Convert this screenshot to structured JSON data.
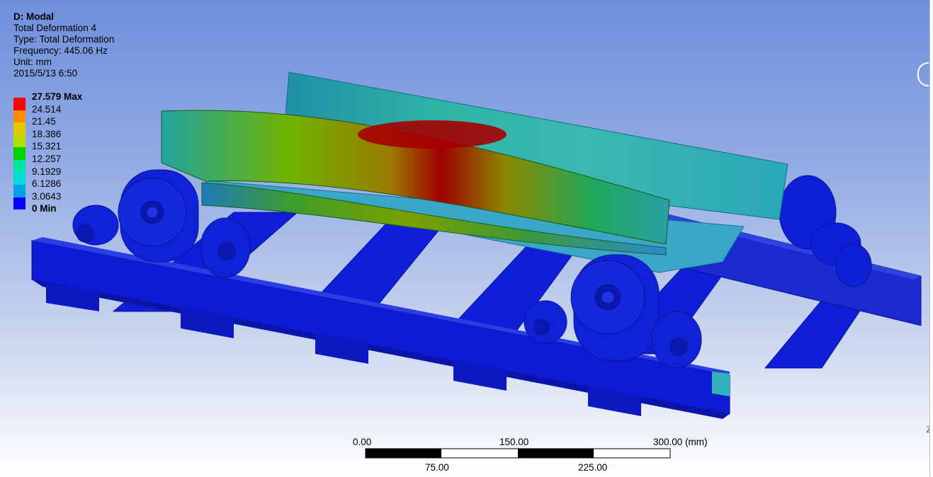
{
  "info": {
    "title": "D: Modal",
    "result": "Total Deformation 4",
    "type": "Type: Total Deformation",
    "frequency": "Frequency: 445.06 Hz",
    "unit": "Unit: mm",
    "timestamp": "2015/5/13 6:50"
  },
  "legend": [
    {
      "label": "27.579 Max",
      "color": "#ff0000",
      "bold": true
    },
    {
      "label": "24.514",
      "color": "#ff8c00",
      "bold": false
    },
    {
      "label": "21.45",
      "color": "#e6c800",
      "bold": false
    },
    {
      "label": "18.386",
      "color": "#b4dc00",
      "bold": false
    },
    {
      "label": "15.321",
      "color": "#00d200",
      "bold": false
    },
    {
      "label": "12.257",
      "color": "#00e6a0",
      "bold": false
    },
    {
      "label": "9.1929",
      "color": "#00dcdc",
      "bold": false
    },
    {
      "label": "6.1286",
      "color": "#00a0e6",
      "bold": false
    },
    {
      "label": "3.0643",
      "color": "#0000ff",
      "bold": false
    },
    {
      "label": "0 Min",
      "color": "#0000ff",
      "bold": true
    }
  ],
  "scale_bar": {
    "top_labels": [
      "0.00",
      "150.00",
      "300.00 (mm)"
    ],
    "bottom_labels": [
      "75.00",
      "225.00"
    ]
  },
  "axis_label": "Z"
}
